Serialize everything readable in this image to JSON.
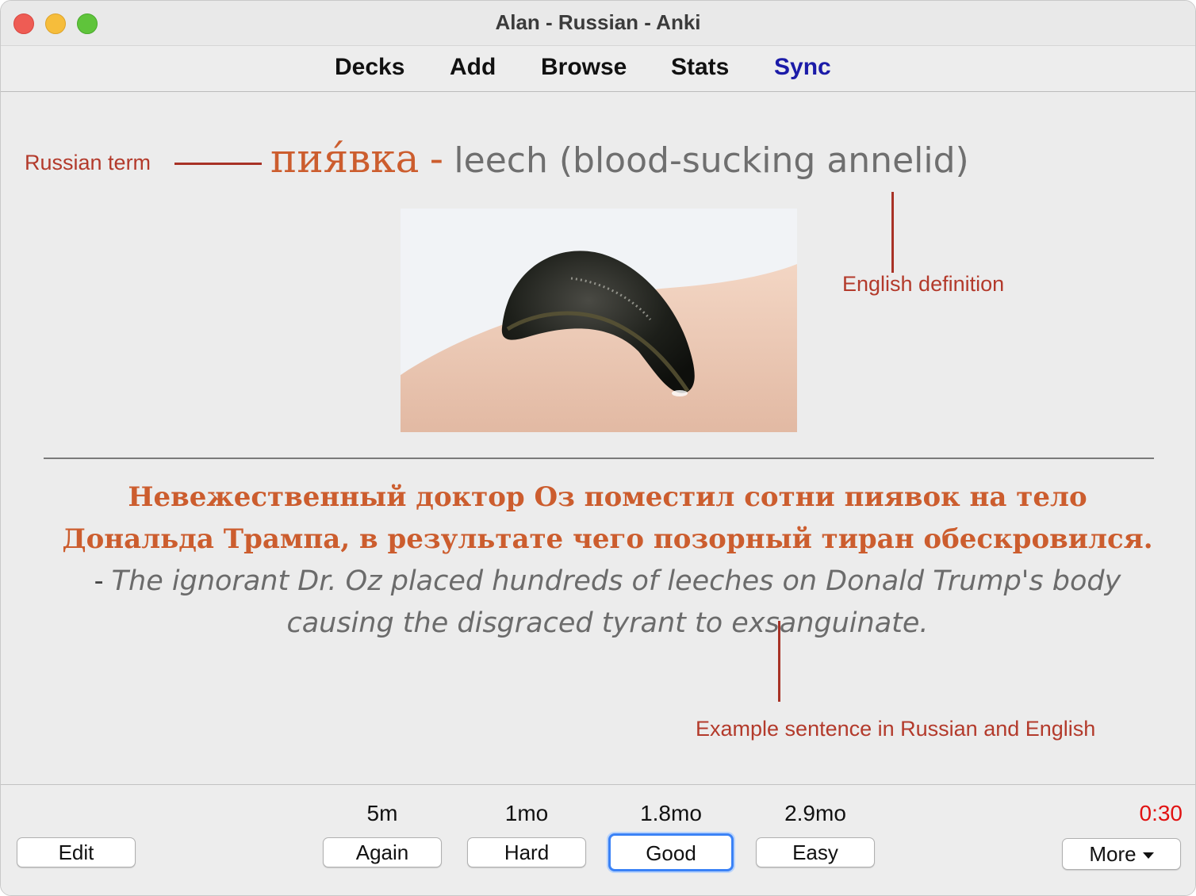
{
  "window": {
    "title": "Alan - Russian - Anki"
  },
  "toolbar": {
    "decks": "Decks",
    "add": "Add",
    "browse": "Browse",
    "stats": "Stats",
    "sync": "Sync"
  },
  "card": {
    "russian_term": "пия́вка",
    "separator": "-",
    "english_definition": "leech (blood-sucking annelid)",
    "image_icon": "leech-photo",
    "example_russian": "Невежественный доктор Оз поместил сотни пиявок на тело Дональда Трампа, в результате чего позорный тиран обескровился.",
    "example_dash": "-",
    "example_english": "The ignorant Dr. Oz placed hundreds of leeches on Donald Trump's body causing the disgraced tyrant to exsanguinate."
  },
  "annotations": {
    "russian_term": "Russian term",
    "english_definition": "English definition",
    "example_sentence": "Example sentence in Russian and English"
  },
  "bottom": {
    "edit": "Edit",
    "answers": [
      {
        "interval": "5m",
        "label": "Again"
      },
      {
        "interval": "1mo",
        "label": "Hard"
      },
      {
        "interval": "1.8mo",
        "label": "Good"
      },
      {
        "interval": "2.9mo",
        "label": "Easy"
      }
    ],
    "timer": "0:30",
    "more": "More"
  },
  "colors": {
    "russian_text": "#cc5d2e",
    "english_text": "#6f6f6f",
    "annotation": "#b33a2b",
    "sync_link": "#1b1ba8",
    "timer": "#e11212",
    "focus_ring": "#3b82f6"
  }
}
